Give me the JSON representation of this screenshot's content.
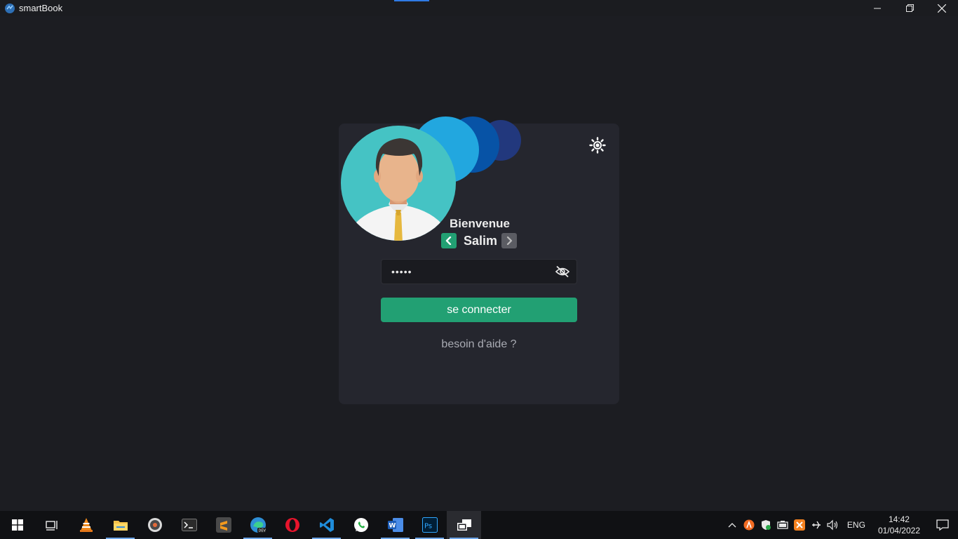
{
  "window": {
    "title": "smartBook"
  },
  "login": {
    "welcome": "Bienvenue",
    "username": "Salim",
    "password_value": "•••••",
    "connect_label": "se connecter",
    "help_label": "besoin d'aide ?"
  },
  "taskbar": {
    "apps": [
      "windows-start",
      "task-view",
      "vlc",
      "file-explorer",
      "media-player",
      "terminal",
      "sublime-text",
      "edge-dev",
      "opera",
      "vscode",
      "whatsapp",
      "word",
      "photoshop",
      "smartbook"
    ],
    "language": "ENG",
    "time": "14:42",
    "date": "01/04/2022"
  },
  "colors": {
    "accent_green": "#22a073",
    "card_bg": "#25262e",
    "window_bg": "#1c1d22",
    "avatar_bg": "#45c3c4"
  }
}
